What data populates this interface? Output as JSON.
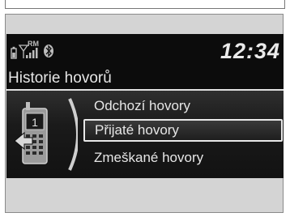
{
  "status": {
    "signal_label": "RM",
    "bluetooth": "bluetooth-icon",
    "clock": "12:34"
  },
  "screen_title": "Historie hovorů",
  "menu": {
    "items": [
      {
        "label": "Odchozí hovory",
        "selected": false
      },
      {
        "label": "Přijaté hovory",
        "selected": true
      },
      {
        "label": "Zmeškané hovory",
        "selected": false
      }
    ]
  },
  "icon": {
    "phone_badge": "1"
  },
  "colors": {
    "screen_bg": "#0c0c0c",
    "text": "#e6e6e6",
    "frame_bg": "#d4d4d4"
  }
}
